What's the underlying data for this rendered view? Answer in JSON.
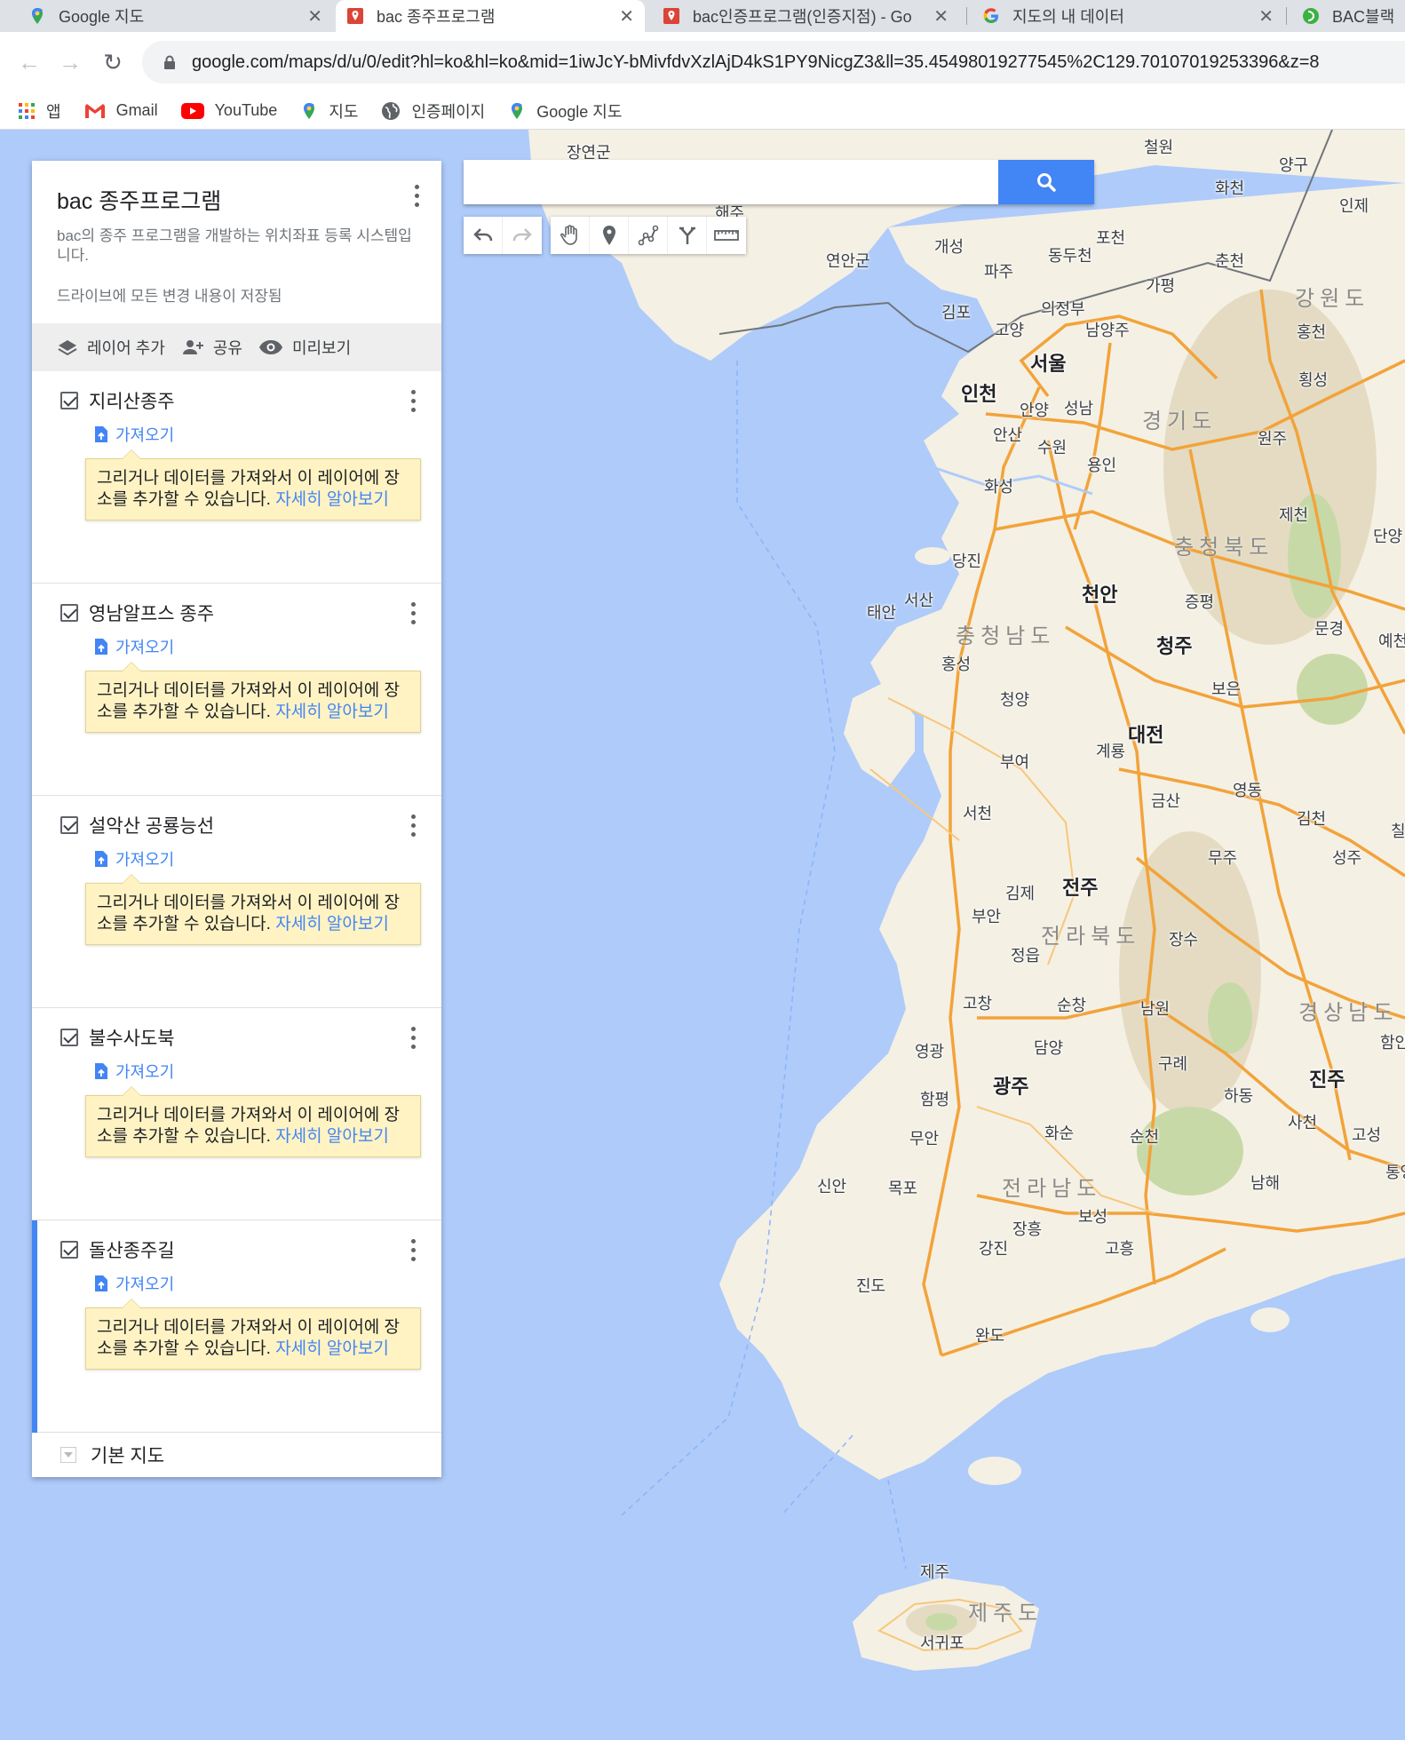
{
  "tabs": [
    {
      "title": "Google 지도",
      "icon": "maps-pin-icon",
      "active": false
    },
    {
      "title": "bac 종주프로그램",
      "icon": "mymaps-icon",
      "active": true
    },
    {
      "title": "bac인증프로그램(인증지점) - Go",
      "icon": "mymaps-icon",
      "active": false
    },
    {
      "title": "지도의 내 데이터",
      "icon": "google-g-icon",
      "active": false
    },
    {
      "title": "BAC블랙야",
      "icon": "bac-icon",
      "active": false
    }
  ],
  "address": {
    "url": "google.com/maps/d/u/0/edit?hl=ko&hl=ko&mid=1iwJcY-bMivfdvXzlAjD4kS1PY9NicgZ3&ll=35.45498019277545%2C129.70107019253396&z=8"
  },
  "bookmarks": [
    {
      "label": "앱",
      "icon": "apps-grid-icon"
    },
    {
      "label": "Gmail",
      "icon": "gmail-icon"
    },
    {
      "label": "YouTube",
      "icon": "youtube-icon"
    },
    {
      "label": "지도",
      "icon": "maps-pin-icon"
    },
    {
      "label": "인증페이지",
      "icon": "globe-icon"
    },
    {
      "label": "Google 지도",
      "icon": "maps-pin-icon"
    }
  ],
  "search": {
    "placeholder": ""
  },
  "panel": {
    "title": "bac 종주프로그램",
    "description": "bac의 종주 프로그램을 개발하는 위치좌표 등록 시스템입니다.",
    "saved_status": "드라이브에 모든 변경 내용이 저장됨",
    "actions": {
      "add_layer": "레이어 추가",
      "share": "공유",
      "preview": "미리보기"
    },
    "layers": [
      {
        "name": "지리산종주",
        "import_label": "가져오기",
        "hint": "그리거나 데이터를 가져와서 이 레이어에 장소를 추가할 수 있습니다.",
        "learn_more": "자세히 알아보기",
        "checked": true,
        "selected": false
      },
      {
        "name": "영남알프스 종주",
        "import_label": "가져오기",
        "hint": "그리거나 데이터를 가져와서 이 레이어에 장소를 추가할 수 있습니다.",
        "learn_more": "자세히 알아보기",
        "checked": true,
        "selected": false
      },
      {
        "name": "설악산 공룡능선",
        "import_label": "가져오기",
        "hint": "그리거나 데이터를 가져와서 이 레이어에 장소를 추가할 수 있습니다.",
        "learn_more": "자세히 알아보기",
        "checked": true,
        "selected": false
      },
      {
        "name": "불수사도북",
        "import_label": "가져오기",
        "hint": "그리거나 데이터를 가져와서 이 레이어에 장소를 추가할 수 있습니다.",
        "learn_more": "자세히 알아보기",
        "checked": true,
        "selected": false
      },
      {
        "name": "돌산종주길",
        "import_label": "가져오기",
        "hint": "그리거나 데이터를 가져와서 이 레이어에 장소를 추가할 수 있습니다.",
        "learn_more": "자세히 알아보기",
        "checked": true,
        "selected": true
      }
    ],
    "base_map": "기본 지도"
  },
  "map_labels": {
    "cities": [
      "장연군",
      "연안군",
      "개성",
      "파주",
      "김포",
      "고양",
      "의정부",
      "남양주",
      "동두천",
      "포천",
      "가평",
      "춘천",
      "화천",
      "양구",
      "철원",
      "인제",
      "홍천",
      "횡성",
      "서울",
      "인천",
      "안양",
      "성남",
      "안산",
      "수원",
      "용인",
      "화성",
      "원주",
      "제천",
      "단양",
      "당진",
      "서산",
      "태안",
      "천안",
      "증평",
      "청주",
      "홍성",
      "청양",
      "부여",
      "계룡",
      "대전",
      "보은",
      "문경",
      "예천",
      "영동",
      "김천",
      "서천",
      "금산",
      "무주",
      "성주",
      "김제",
      "전주",
      "부안",
      "장수",
      "정읍",
      "고창",
      "순창",
      "남원",
      "영광",
      "담양",
      "광주",
      "구례",
      "함평",
      "하동",
      "진주",
      "무안",
      "화순",
      "순천",
      "사천",
      "고성",
      "신안",
      "목포",
      "남해",
      "통영",
      "장흥",
      "보성",
      "강진",
      "고흥",
      "진도",
      "완도",
      "제주",
      "서귀포",
      "해주",
      "함안",
      "칠곡"
    ],
    "provinces": [
      "경기도",
      "강원도",
      "충청북도",
      "충청남도",
      "전라북도",
      "경상남도",
      "전라남도",
      "제주도"
    ]
  },
  "colors": {
    "accent": "#4285f4",
    "road": "#f2a33a",
    "water": "#aecbfa",
    "land": "#f5f0e4",
    "hint_bg": "#fff3c4"
  }
}
